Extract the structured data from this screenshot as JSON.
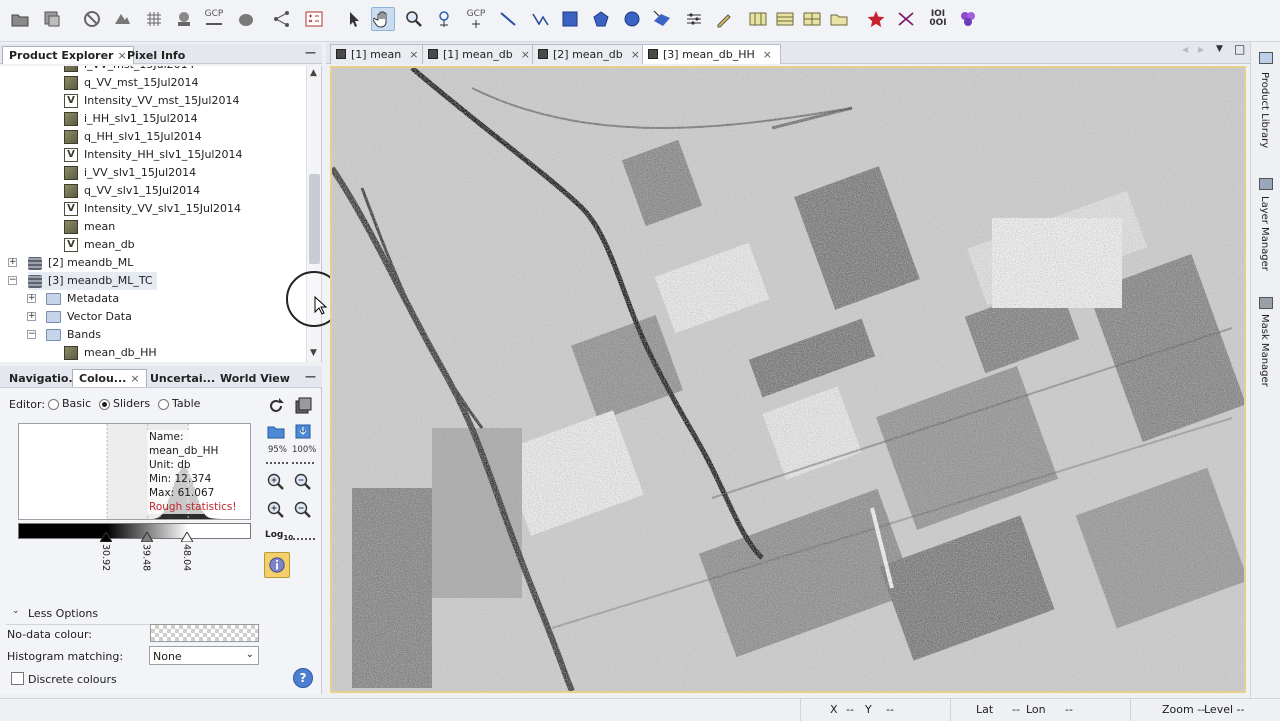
{
  "toolbar": {
    "icons": [
      "open-product-icon",
      "close-product-icon",
      "no-entry-icon",
      "session-icon",
      "grid-icon",
      "graph-icon",
      "gcp-icon",
      "layers-icon",
      "graph-builder-icon",
      "band-maths-icon",
      "select-icon",
      "pan-icon",
      "zoom-icon",
      "gcp-pin-icon",
      "line-draw-icon",
      "polyline-draw-icon",
      "rectangle-draw-icon",
      "polygon-draw-icon",
      "ellipse-draw-icon",
      "range-finder-icon",
      "magic-wand-icon",
      "pencil-icon",
      "tile-evenly-icon",
      "tile-horizontal-icon",
      "tile-vertical-icon",
      "tile-single-icon",
      "star-icon",
      "axis-icon",
      "binary-icon",
      "dots-icon"
    ],
    "gcp_label": "GCP",
    "binary_label": "IOI 0OI"
  },
  "explorer": {
    "tabs": [
      {
        "label": "Product Explorer",
        "close": "×"
      },
      {
        "label": "Pixel Info"
      }
    ],
    "minimize": "—",
    "tree": [
      {
        "label": "i_VV_mst_15Jul2014",
        "type": "band"
      },
      {
        "label": "q_VV_mst_15Jul2014",
        "type": "band"
      },
      {
        "label": "Intensity_VV_mst_15Jul2014",
        "type": "virtual"
      },
      {
        "label": "i_HH_slv1_15Jul2014",
        "type": "band"
      },
      {
        "label": "q_HH_slv1_15Jul2014",
        "type": "band"
      },
      {
        "label": "Intensity_HH_slv1_15Jul2014",
        "type": "virtual"
      },
      {
        "label": "i_VV_slv1_15Jul2014",
        "type": "band"
      },
      {
        "label": "q_VV_slv1_15Jul2014",
        "type": "band"
      },
      {
        "label": "Intensity_VV_slv1_15Jul2014",
        "type": "virtual"
      },
      {
        "label": "mean",
        "type": "band"
      },
      {
        "label": "mean_db",
        "type": "virtual"
      },
      {
        "label": "[2] meandb_ML",
        "type": "product",
        "expander": "+"
      },
      {
        "label": "[3] meandb_ML_TC",
        "type": "product",
        "expander": "−"
      },
      {
        "label": "Metadata",
        "type": "folder",
        "expander": "+"
      },
      {
        "label": "Vector Data",
        "type": "folder",
        "expander": "+"
      },
      {
        "label": "Bands",
        "type": "folder",
        "expander": "−"
      },
      {
        "label": "mean_db_HH",
        "type": "band"
      }
    ]
  },
  "colour": {
    "tabs": [
      {
        "label": "Navigatio..."
      },
      {
        "label": "Colou...",
        "close": "×"
      },
      {
        "label": "Uncertai..."
      },
      {
        "label": "World View"
      }
    ],
    "minimize": "—",
    "editor_label": "Editor:",
    "editor_options": [
      "Basic",
      "Sliders",
      "Table"
    ],
    "editor_selected": "Sliders",
    "info": {
      "name": "Name: mean_db_HH",
      "unit": "Unit: db",
      "min": "Min: 12.374",
      "max": "Max: 61.067",
      "rough": "Rough statistics!"
    },
    "histogram": [
      0,
      0,
      0,
      0,
      0,
      0,
      0,
      0,
      0,
      0,
      0,
      0,
      0,
      0,
      0,
      0,
      0,
      0,
      0,
      0,
      0,
      0,
      0,
      0,
      0,
      0,
      0,
      0,
      0,
      0,
      0,
      0,
      0,
      0,
      0,
      0,
      0,
      0,
      0,
      0,
      0,
      0,
      0,
      0,
      0,
      0,
      0,
      0,
      0,
      0,
      0,
      0,
      0,
      0,
      0,
      0,
      0,
      0,
      0,
      0,
      0,
      0,
      0,
      0,
      0,
      0,
      0,
      0,
      0,
      0,
      0,
      0,
      0,
      0,
      0,
      0,
      0,
      0,
      0,
      0,
      0,
      0,
      0,
      0,
      0,
      0,
      0,
      0,
      0,
      0,
      0,
      0,
      0.005,
      0.01,
      0.02,
      0.03,
      0.05,
      0.08,
      0.12,
      0.17,
      0.23,
      0.3,
      0.38,
      0.46,
      0.54,
      0.62,
      0.7,
      0.77,
      0.84,
      0.9,
      0.95,
      0.98,
      1,
      0.99,
      0.96,
      0.92,
      0.86,
      0.79,
      0.71,
      0.62,
      0.53,
      0.44,
      0.36,
      0.28,
      0.21,
      0.15,
      0.1,
      0.07,
      0.045,
      0.03,
      0.02,
      0.015,
      0.01,
      0.007,
      0.005,
      0.003,
      0.002,
      0.001,
      0,
      0,
      0,
      0,
      0,
      0,
      0,
      0,
      0,
      0,
      0,
      0,
      0,
      0,
      0,
      0,
      0,
      0,
      0,
      0
    ],
    "histogram_range": [
      12.374,
      61.067
    ],
    "sliders": [
      {
        "value": 30.92,
        "label": "30.92"
      },
      {
        "value": 39.48,
        "label": "39.48"
      },
      {
        "value": 48.04,
        "label": "48.04"
      }
    ],
    "zoom_95": "95%",
    "zoom_100": "100%",
    "log_label": "Log",
    "log_sub": "10",
    "less_options": "Less Options",
    "nodata_label": "No-data colour:",
    "hist_match_label": "Histogram matching:",
    "hist_match_value": "None",
    "discrete_label": "Discrete colours",
    "help_label": "?"
  },
  "editor": {
    "tabs": [
      {
        "label": "[1] mean",
        "close": "×"
      },
      {
        "label": "[1] mean_db",
        "close": "×"
      },
      {
        "label": "[2] mean_db",
        "close": "×"
      },
      {
        "label": "[3] mean_db_HH",
        "close": "×",
        "active": true
      }
    ],
    "nav_prev": "◀",
    "nav_next": "▶",
    "nav_menu": "▼",
    "maximize": "□"
  },
  "right_panels": [
    "Product Library",
    "Layer Manager",
    "Mask Manager"
  ],
  "status": {
    "x": "X",
    "x_val": "--",
    "y": "Y",
    "y_val": "--",
    "lat": "Lat",
    "lat_val": "--",
    "lon": "Lon",
    "lon_val": "--",
    "zoom": "Zoom --",
    "level": "Level --"
  }
}
